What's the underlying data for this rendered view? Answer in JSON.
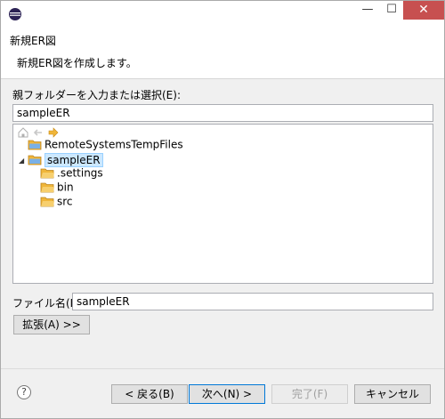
{
  "window": {
    "controls": {
      "minimize": "—",
      "maximize": "☐",
      "close": "✕"
    }
  },
  "banner": {
    "title": "新規ER図",
    "description": "新規ER図を作成します。"
  },
  "parent_folder": {
    "label": "親フォルダーを入力または選択(E):",
    "value": "sampleER"
  },
  "tree": {
    "items": [
      {
        "label": "RemoteSystemsTempFiles",
        "depth": 0,
        "expanded": false,
        "selected": false
      },
      {
        "label": "sampleER",
        "depth": 0,
        "expanded": true,
        "selected": true
      },
      {
        "label": ".settings",
        "depth": 1,
        "expanded": false,
        "selected": false
      },
      {
        "label": "bin",
        "depth": 1,
        "expanded": false,
        "selected": false
      },
      {
        "label": "src",
        "depth": 1,
        "expanded": false,
        "selected": false
      }
    ]
  },
  "file_name": {
    "label": "ファイル名(M):",
    "value": "sampleER"
  },
  "buttons": {
    "advanced": "拡張(A) >>",
    "back": "< 戻る(B)",
    "next": "次へ(N) >",
    "finish": "完了(F)",
    "cancel": "キャンセル",
    "help": "?"
  },
  "colors": {
    "selection": "#cce8ff",
    "close_button": "#c75050",
    "folder": "#f0b63a"
  }
}
